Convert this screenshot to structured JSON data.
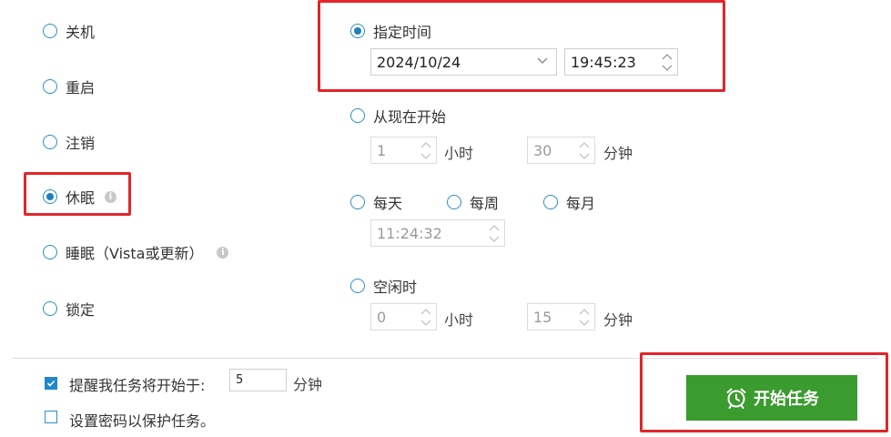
{
  "actions": {
    "shutdown": "关机",
    "restart": "重启",
    "logoff": "注销",
    "hibernate": "休眠",
    "sleep": "睡眠（Vista或更新）",
    "lock": "锁定",
    "selected": "hibernate"
  },
  "schedule": {
    "specific_time": {
      "label": "指定时间",
      "date": "2024/10/24",
      "time": "19:45:23"
    },
    "from_now": {
      "label": "从现在开始",
      "hours": "1",
      "hours_unit": "小时",
      "minutes": "30",
      "minutes_unit": "分钟"
    },
    "daily": "每天",
    "weekly": "每周",
    "monthly": "每月",
    "recurring_time": "11:24:32",
    "idle": {
      "label": "空闲时",
      "hours": "0",
      "hours_unit": "小时",
      "minutes": "15",
      "minutes_unit": "分钟"
    },
    "selected": "specific_time"
  },
  "footer": {
    "remind_label": "提醒我任务将开始于:",
    "remind_value": "5",
    "remind_unit": "分钟",
    "remind_checked": true,
    "password_label": "设置密码以保护任务。",
    "password_checked": false,
    "start_button": "开始任务"
  },
  "colors": {
    "accent": "#1f7fbf",
    "highlight": "#e0262b",
    "start": "#3a9b2e"
  }
}
